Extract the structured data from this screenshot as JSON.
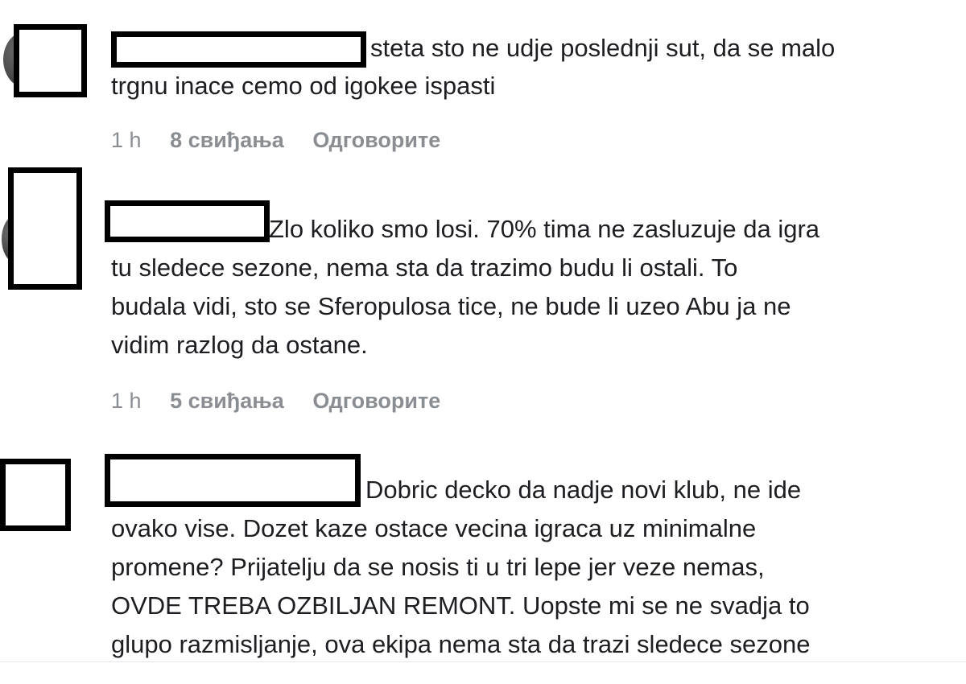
{
  "comments": [
    {
      "author": "",
      "lines": [
        "steta sto ne udje poslednji sut, da se malo",
        "trgnu inace cemo od igokee ispasti"
      ],
      "time": "1 h",
      "likes": "8 свиђања",
      "reply": "Одговорите"
    },
    {
      "author": "",
      "lines": [
        "Zlo koliko smo losi. 70% tima ne zasluzuje da igra",
        "tu sledece sezone, nema sta da trazimo budu li ostali. To",
        "budala vidi, sto se Sferopulosa tice, ne bude li uzeo Abu ja ne",
        "vidim razlog da ostane."
      ],
      "time": "1 h",
      "likes": "5 свиђања",
      "reply": "Одговорите"
    },
    {
      "author": "",
      "lines": [
        "Dobric decko da nadje novi klub, ne ide",
        "ovako vise. Dozet kaze ostace vecina igraca uz minimalne",
        "promene? Prijatelju da se nosis ti u tri lepe jer veze nemas,",
        "OVDE TREBA OZBILJAN REMONT. Uopste mi se ne svadja to",
        "glupo razmisljanje, ova ekipa nema sta da trazi sledece sezone"
      ]
    }
  ]
}
